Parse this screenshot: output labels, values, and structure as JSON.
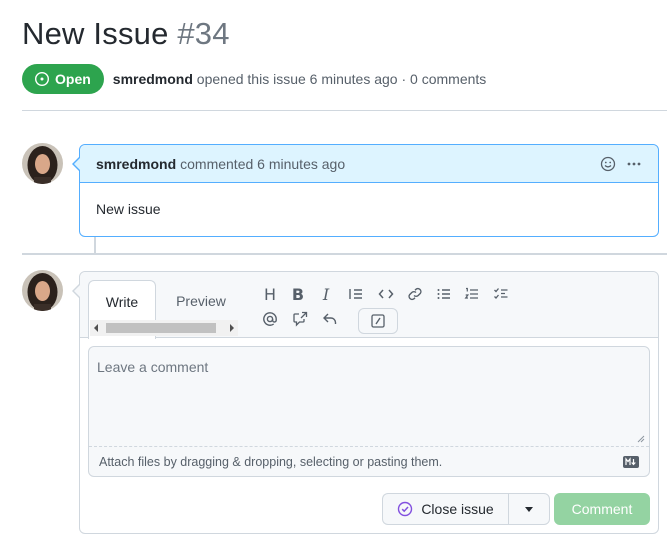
{
  "issue": {
    "title": "New Issue",
    "number": "#34",
    "state_label": "Open",
    "author": "smredmond",
    "meta_text": "opened this issue 6 minutes ago · 0 comments"
  },
  "comment": {
    "author": "smredmond",
    "meta_text": "commented 6 minutes ago",
    "body": "New issue"
  },
  "editor": {
    "tabs": [
      "Write",
      "Preview"
    ],
    "toolbar": {
      "heading": "H",
      "bold": "B",
      "italic": "I"
    },
    "placeholder": "Leave a comment",
    "attach_text": "Attach files by dragging & dropping, selecting or pasting them."
  },
  "actions": {
    "close_label": "Close issue",
    "comment_label": "Comment"
  },
  "colors": {
    "open_green": "#2da44e",
    "comment_header": "#ddf4ff",
    "comment_border": "#54aeff",
    "comment_button": "#94d3a2",
    "close_icon": "#8250df"
  },
  "icons": [
    "issue-opened-icon",
    "smiley-icon",
    "kebab-icon",
    "quote-icon",
    "code-icon",
    "link-icon",
    "unordered-list-icon",
    "ordered-list-icon",
    "tasklist-icon",
    "mention-icon",
    "cross-reference-icon",
    "reply-icon",
    "slash-command-icon",
    "markdown-icon",
    "issue-closed-icon"
  ]
}
